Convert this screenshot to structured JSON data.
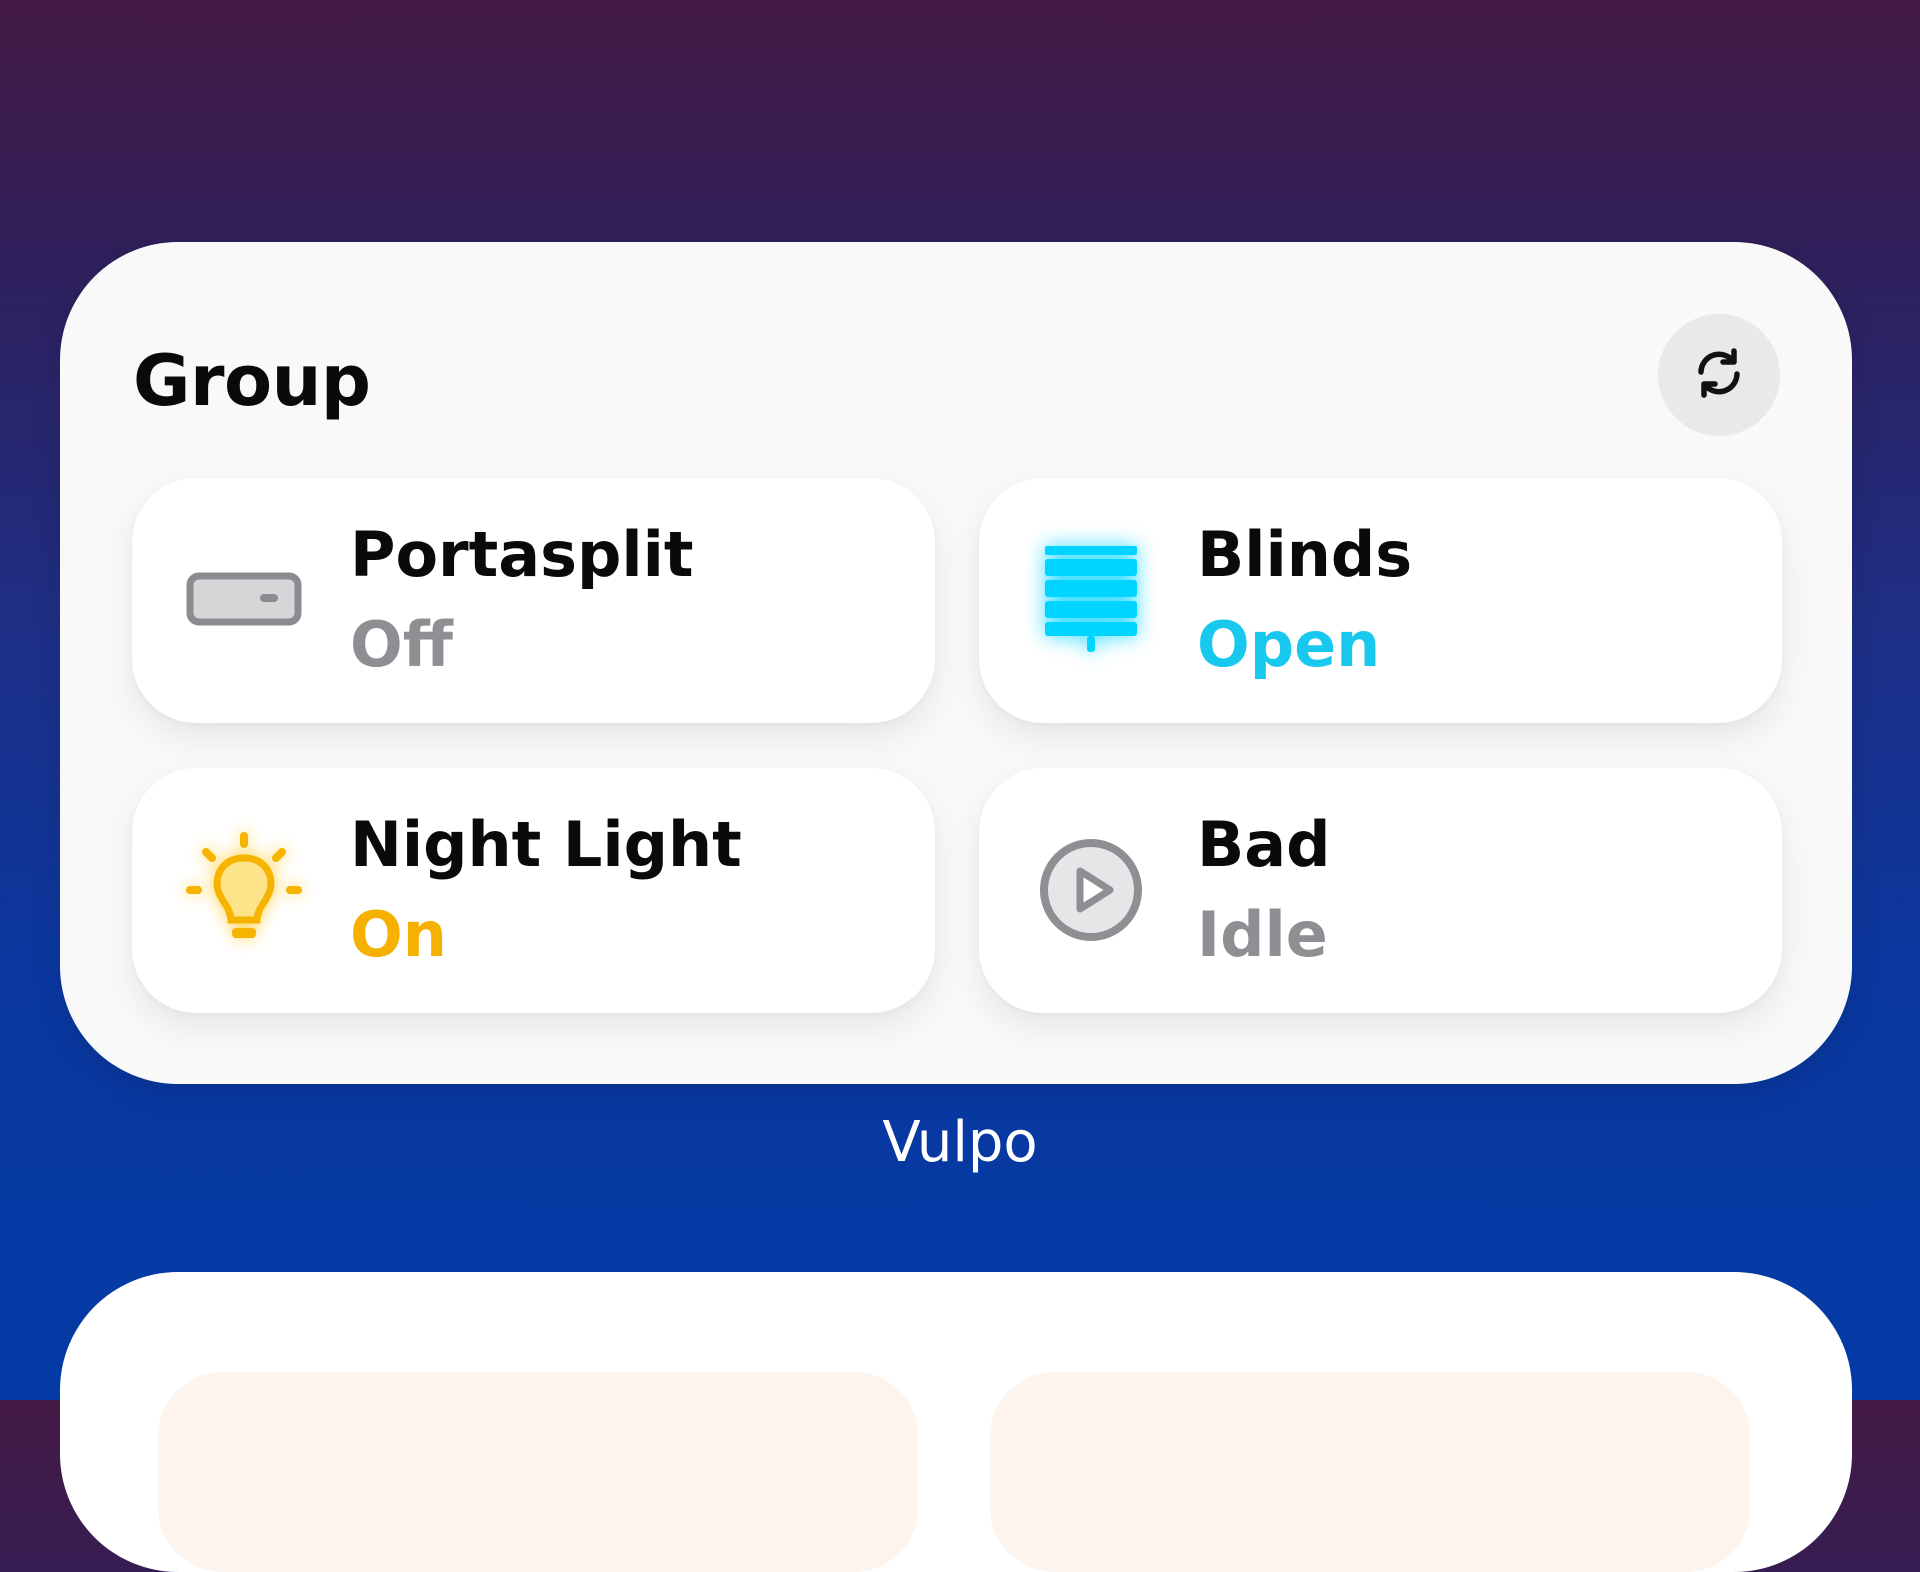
{
  "widget": {
    "title": "Group",
    "refresh_icon": "refresh-icon",
    "tiles": [
      {
        "name": "Portasplit",
        "state": "Off",
        "icon": "air-conditioner-icon",
        "state_color": "#8e8e93"
      },
      {
        "name": "Blinds",
        "state": "Open",
        "icon": "blinds-icon",
        "state_color": "#19c8ef"
      },
      {
        "name": "Night Light",
        "state": "On",
        "icon": "lightbulb-icon",
        "state_color": "#f5b000"
      },
      {
        "name": "Bad",
        "state": "Idle",
        "icon": "play-circle-icon",
        "state_color": "#8e8e93"
      }
    ]
  },
  "widget_label": "Vulpo"
}
